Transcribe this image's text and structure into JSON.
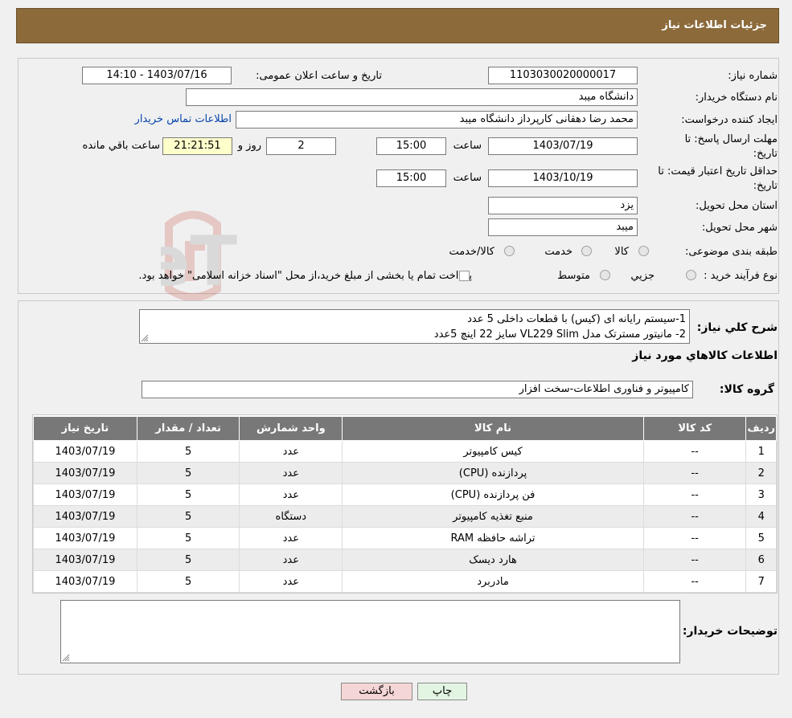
{
  "header": {
    "title": "جزئیات اطلاعات نیاز"
  },
  "form": {
    "need_number_label": "شماره نیاز:",
    "need_number": "1103030020000017",
    "announce_label": "تاریخ و ساعت اعلان عمومی:",
    "announce_value": "1403/07/16 - 14:10",
    "buyer_org_label": "نام دستگاه خریدار:",
    "buyer_org": "دانشگاه میبد",
    "creator_label": "ایجاد کننده درخواست:",
    "creator": "محمد رضا دهقانی کارپرداز دانشگاه میبد",
    "contact_link": "اطلاعات تماس خریدار",
    "deadline_label_1": "مهلت ارسال پاسخ: تا",
    "deadline_label_2": "تاریخ:",
    "deadline_date": "1403/07/19",
    "time_label": "ساعت",
    "deadline_time": "15:00",
    "days_value": "2",
    "days_label": "روز و",
    "remaining_time": "21:21:51",
    "remaining_label": "ساعت باقي مانده",
    "validity_label_1": "حداقل تاریخ اعتبار قیمت: تا",
    "validity_label_2": "تاریخ:",
    "validity_date": "1403/10/19",
    "validity_time": "15:00",
    "province_label": "استان محل تحویل:",
    "province": "یزد",
    "city_label": "شهر محل تحویل:",
    "city": "میبد",
    "category_label": "طبقه بندی موضوعی:",
    "category_options": [
      "کالا",
      "خدمت",
      "کالا/خدمت"
    ],
    "process_label": "نوع فرآیند خرید :",
    "process_options": [
      "جزیي",
      "متوسط"
    ],
    "process_note": "پرداخت تمام یا بخشی از مبلغ خرید،از محل \"اسناد خزانه اسلامی\" خواهد بود."
  },
  "description": {
    "label": "شرح کلي نياز:",
    "line1": "1-سیستم رایانه ای (کیس) با قطعات داخلی  5 عدد",
    "line2": "2- مانیتور مسترتک مدل VL229 Slim سایز 22 اینچ 5عدد"
  },
  "goods_section": {
    "title": "اطلاعات کالاهاي مورد نياز",
    "group_label": "گروه کالا:",
    "group_value": "کامپیوتر و فناوری اطلاعات-سخت افزار"
  },
  "table": {
    "headers": [
      "رديف",
      "کد کالا",
      "نام کالا",
      "واحد شمارش",
      "تعداد / مقدار",
      "تاریخ نیاز"
    ],
    "rows": [
      [
        "1",
        "--",
        "کیس کامپیوتر",
        "عدد",
        "5",
        "1403/07/19"
      ],
      [
        "2",
        "--",
        "پردازنده (CPU)",
        "عدد",
        "5",
        "1403/07/19"
      ],
      [
        "3",
        "--",
        "فن پردازنده (CPU)",
        "عدد",
        "5",
        "1403/07/19"
      ],
      [
        "4",
        "--",
        "منبع تغذیه کامپیوتر",
        "دستگاه",
        "5",
        "1403/07/19"
      ],
      [
        "5",
        "--",
        "تراشه حافظه RAM",
        "عدد",
        "5",
        "1403/07/19"
      ],
      [
        "6",
        "--",
        "هارد دیسک",
        "عدد",
        "5",
        "1403/07/19"
      ],
      [
        "7",
        "--",
        "مادربرد",
        "عدد",
        "5",
        "1403/07/19"
      ]
    ]
  },
  "buyer_notes": {
    "label": "توضیحات خریدار:",
    "value": ""
  },
  "buttons": {
    "print": "چاپ",
    "back": "بازگشت"
  },
  "watermark": {
    "text": "AriaTender.neT"
  },
  "colors": {
    "header_bg": "#8c6a3a",
    "table_header_bg": "#787878",
    "link": "#0645ad",
    "remaining_bg": "#ffffcc",
    "back_button_bg": "#f5d6d6",
    "print_button_bg": "#e2f5e2"
  }
}
